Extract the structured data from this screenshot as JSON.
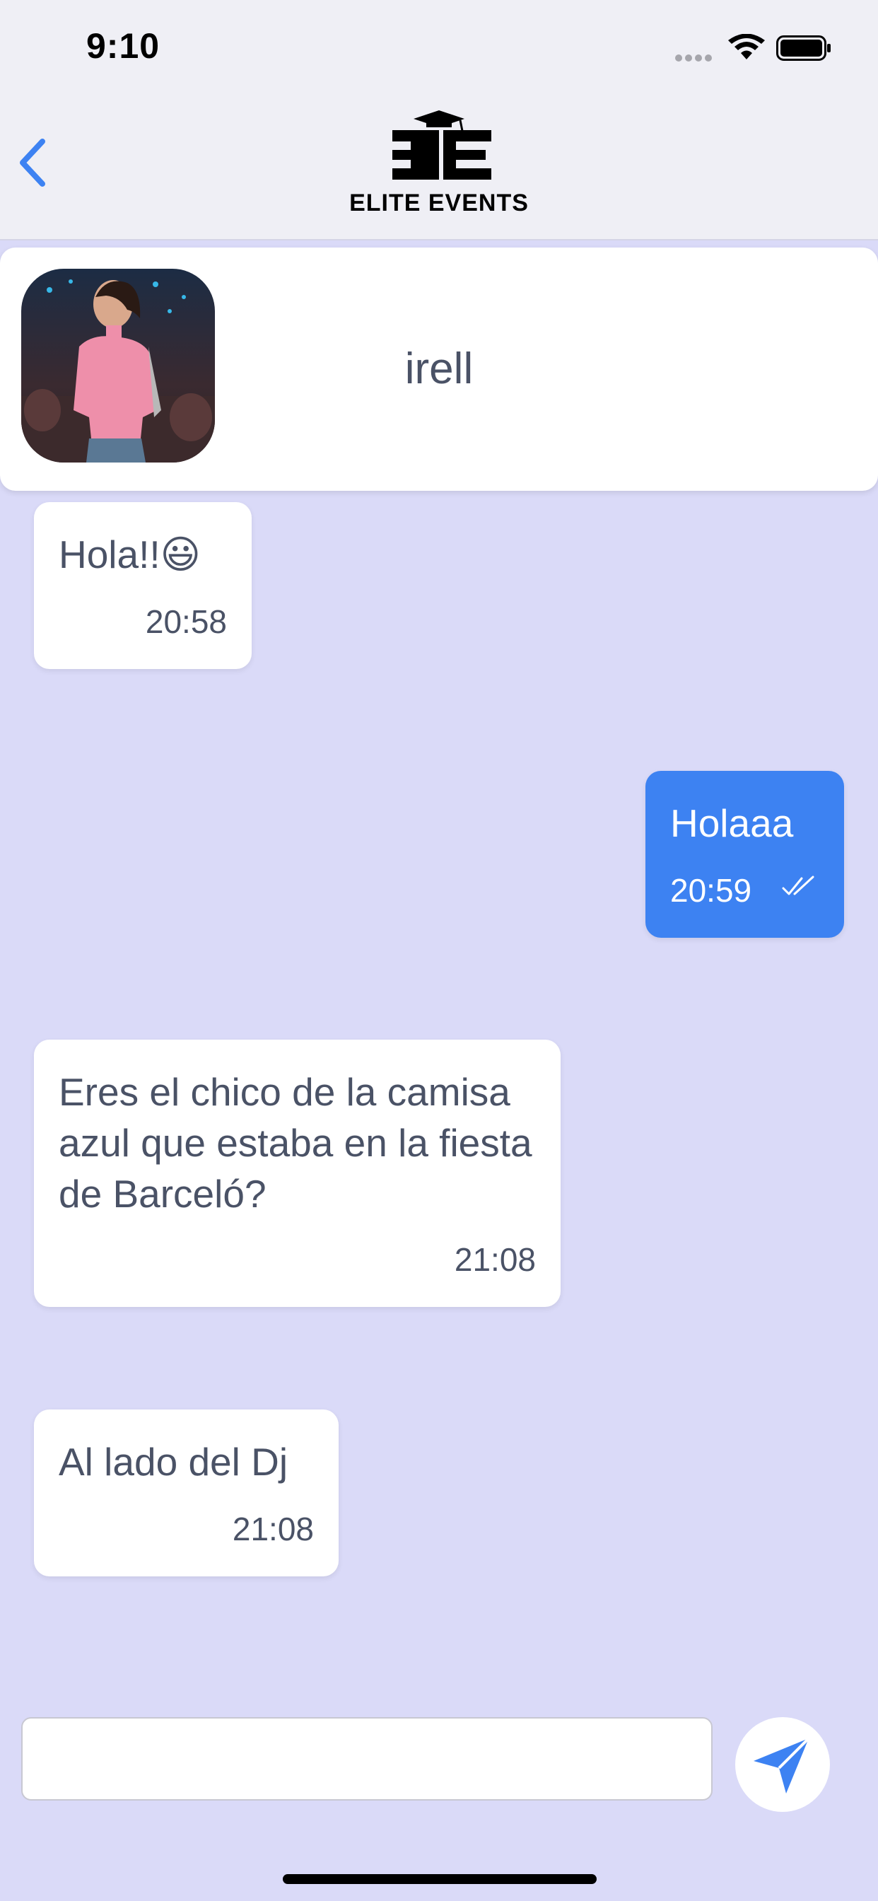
{
  "status_bar": {
    "time": "9:10"
  },
  "header": {
    "logo_text": "ELITE EVENTS",
    "back_icon": "chevron-left-icon"
  },
  "contact": {
    "name": "irell",
    "avatar": "profile-photo-woman-pink-top"
  },
  "messages": [
    {
      "direction": "received",
      "text": "Hola!!😃",
      "time": "20:58"
    },
    {
      "direction": "sent",
      "text": "Holaaa",
      "time": "20:59",
      "status": "read"
    },
    {
      "direction": "received",
      "text": "Eres el chico de la camisa azul que estaba en la fiesta de Barceló?",
      "time": "21:08"
    },
    {
      "direction": "received",
      "text": "Al lado del Dj",
      "time": "21:08"
    }
  ],
  "composer": {
    "value": "",
    "send_icon": "send-icon"
  },
  "colors": {
    "background": "#DADAF8",
    "accent": "#3D82F2",
    "bubble": "#FFFFFF",
    "text": "#4A5266"
  }
}
